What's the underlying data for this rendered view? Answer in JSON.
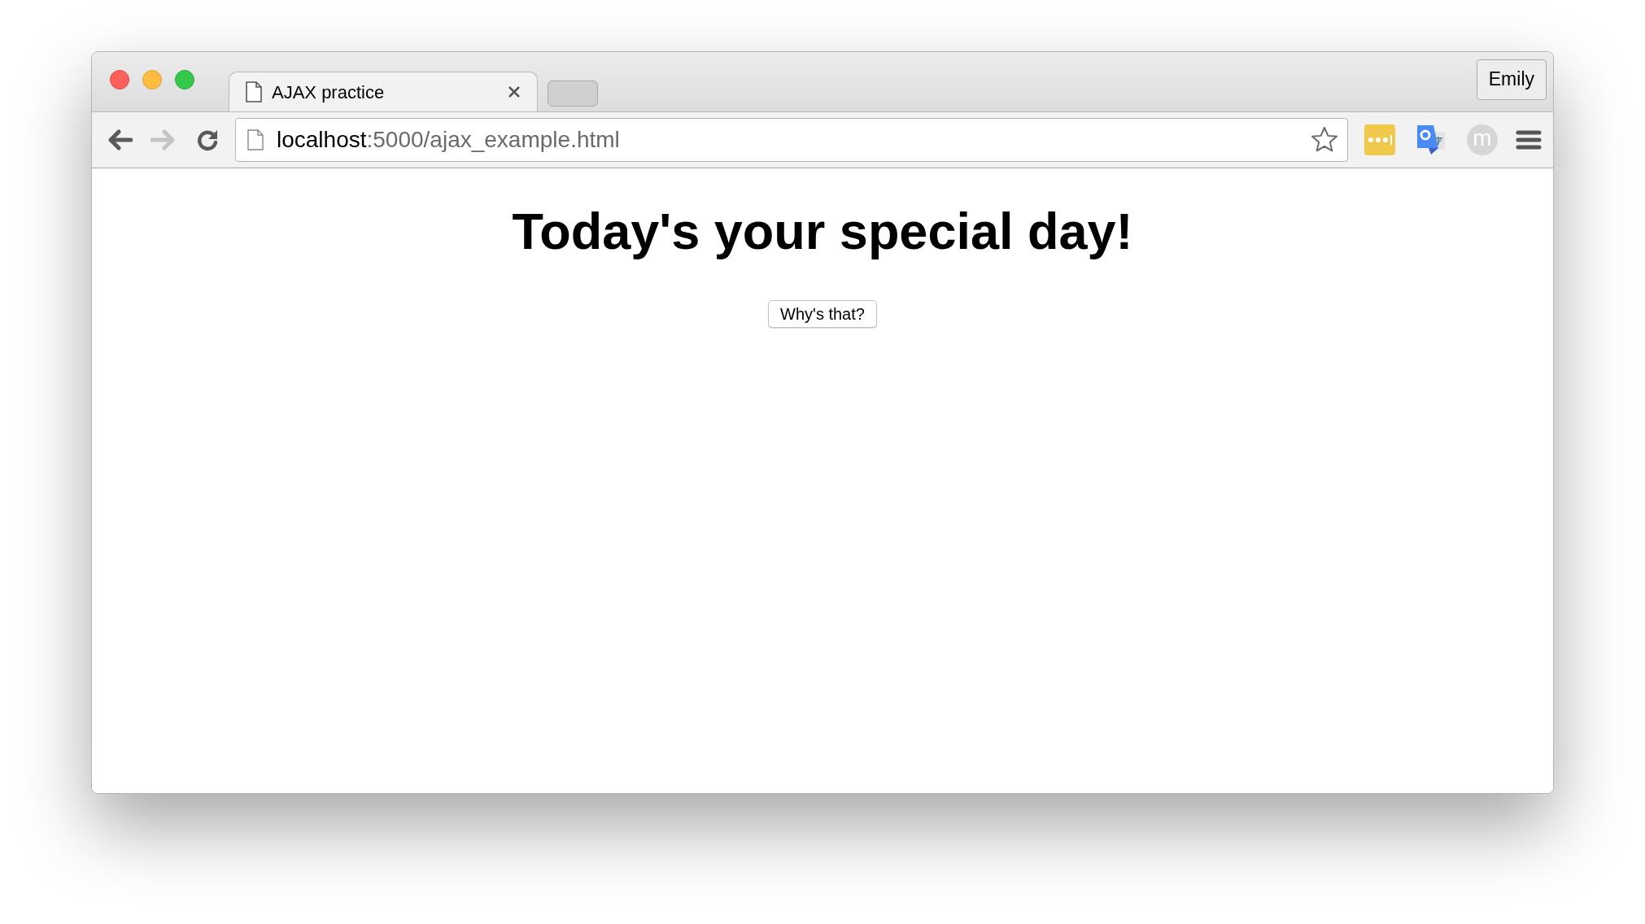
{
  "tabs": [
    {
      "title": "AJAX practice",
      "selected": true
    }
  ],
  "profile": {
    "name": "Emily"
  },
  "address_bar": {
    "host": "localhost",
    "path": ":5000/ajax_example.html"
  },
  "navigation": [
    {
      "kind": "back",
      "disabled": false
    },
    {
      "kind": "forward",
      "disabled": true
    },
    {
      "kind": "reload",
      "disabled": false
    }
  ],
  "extensions": [
    {
      "kind": "password"
    },
    {
      "kind": "translate"
    },
    {
      "kind": "letter",
      "label": "m"
    }
  ],
  "page": {
    "heading": "Today's your special day!",
    "button": "Why's that?"
  }
}
